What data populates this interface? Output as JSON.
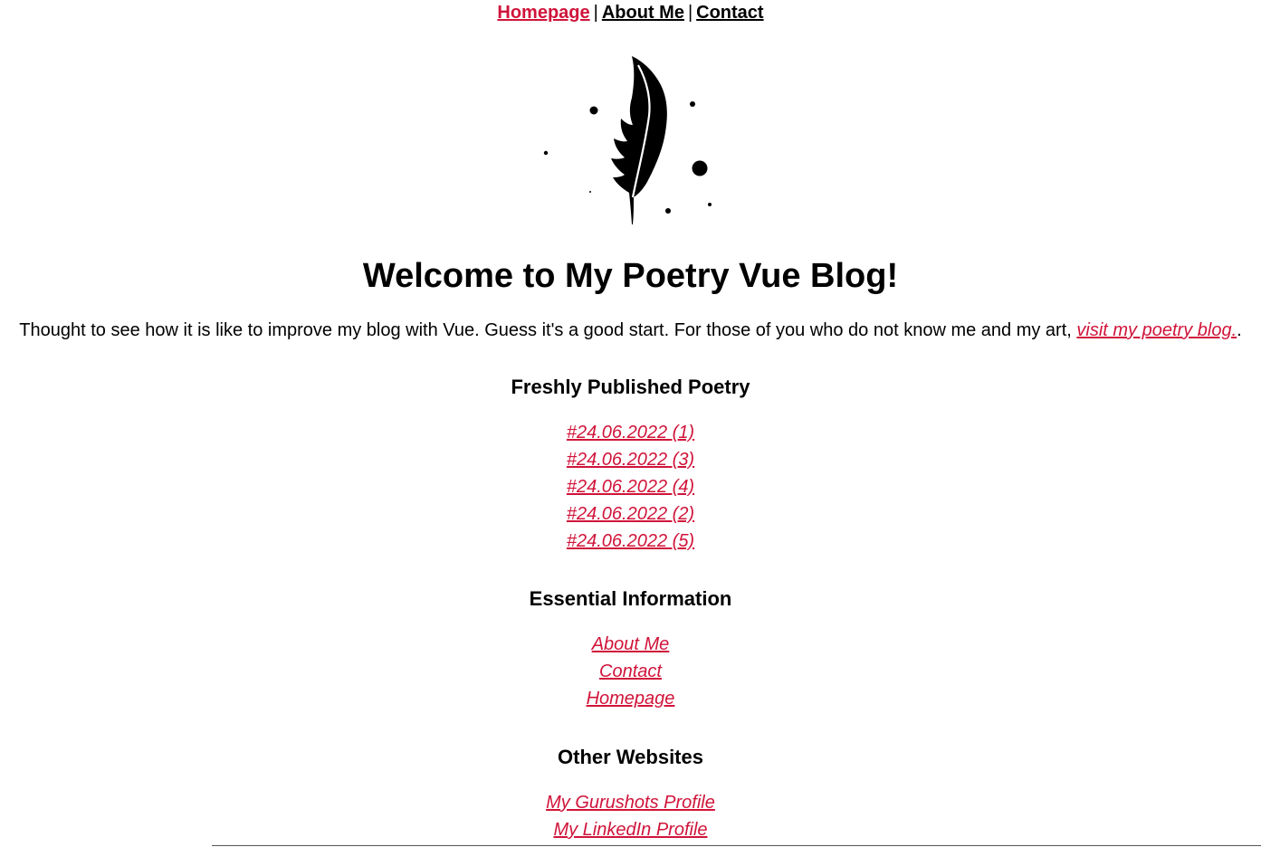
{
  "nav": {
    "items": [
      {
        "label": "Homepage",
        "active": true
      },
      {
        "label": "About Me",
        "active": false
      },
      {
        "label": "Contact",
        "active": false
      }
    ],
    "separator": "|"
  },
  "logo": {
    "icon": "feather-quill-icon"
  },
  "main": {
    "title": "Welcome to My Poetry Vue Blog!",
    "intro_text": "Thought to see how it is like to improve my blog with Vue. Guess it's a good start. For those of you who do not know me and my art, ",
    "intro_link": "visit my poetry blog.",
    "intro_end": "."
  },
  "sections": {
    "fresh": {
      "heading": "Freshly Published Poetry",
      "links": [
        "#24.06.2022 (1)",
        "#24.06.2022 (3)",
        "#24.06.2022 (4)",
        "#24.06.2022 (2)",
        "#24.06.2022 (5)"
      ]
    },
    "info": {
      "heading": "Essential Information",
      "links": [
        "About Me",
        "Contact",
        "Homepage"
      ]
    },
    "other": {
      "heading": "Other Websites",
      "links": [
        "My Gurushots Profile",
        "My LinkedIn Profile"
      ]
    }
  },
  "colors": {
    "accent": "#d0143a",
    "text": "#000000",
    "background": "#ffffff"
  }
}
